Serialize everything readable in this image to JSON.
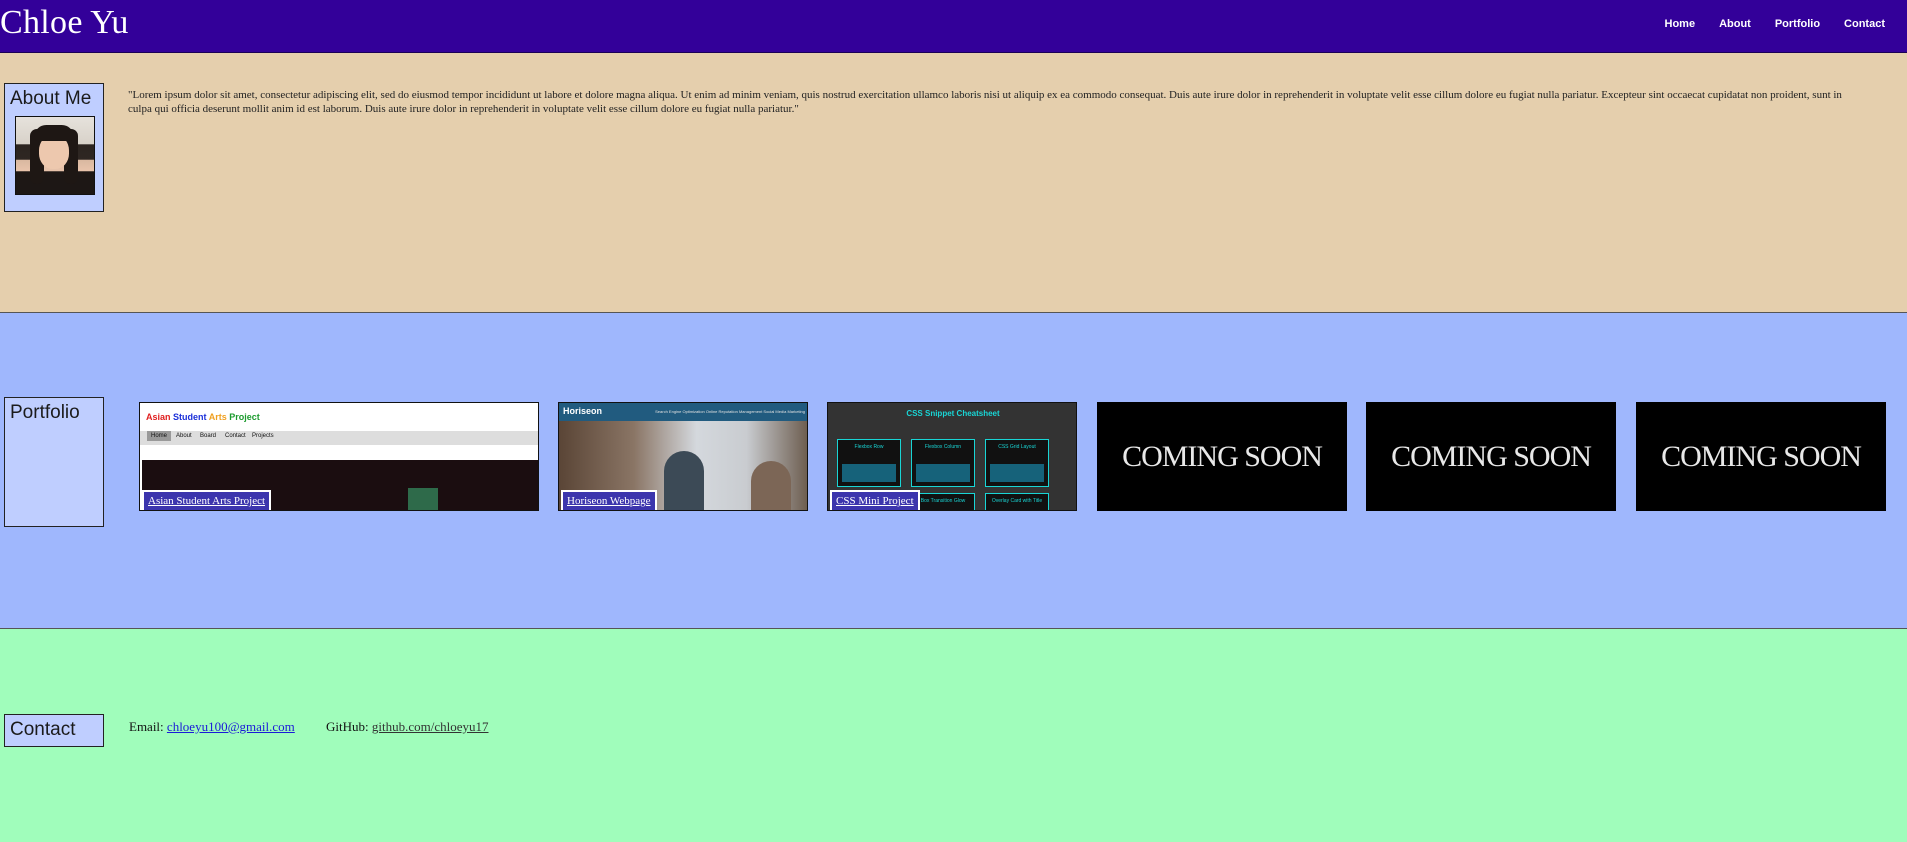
{
  "header": {
    "brand": "Chloe Yu",
    "nav": [
      "Home",
      "About",
      "Portfolio",
      "Contact"
    ]
  },
  "about": {
    "heading": "About Me",
    "avatar_icon": "profile-photo",
    "text": "\"Lorem ipsum dolor sit amet, consectetur adipiscing elit, sed do eiusmod tempor incididunt ut labore et dolore magna aliqua. Ut enim ad minim veniam, quis nostrud exercitation ullamco laboris nisi ut aliquip ex ea commodo consequat. Duis aute irure dolor in reprehenderit in voluptate velit esse cillum dolore eu fugiat nulla pariatur. Excepteur sint occaecat cupidatat non proident, sunt in culpa qui officia deserunt mollit anim id est laborum. Duis aute irure dolor in reprehenderit in voluptate velit esse cillum dolore eu fugiat nulla pariatur.\""
  },
  "portfolio": {
    "heading": "Portfolio",
    "projects": [
      {
        "caption": "Asian Student Arts Project",
        "preview_title": [
          "Asian",
          "Student",
          "Arts",
          "Project"
        ],
        "preview_nav": [
          "Home",
          "About",
          "Board",
          "Contact",
          "Projects"
        ]
      },
      {
        "caption": "Horiseon Webpage",
        "preview_title": "Horiseon",
        "preview_links": "Search Engine Optimization    Online Reputation Management    Social Media Marketing"
      },
      {
        "caption": "CSS Mini Project",
        "preview_title": "CSS Snippet Cheatsheet",
        "preview_cards": [
          "Flexbox Row",
          "Flexbox Column",
          "CSS Grid Layout",
          "Box Transition Glow",
          "Overlay Card with Title"
        ]
      }
    ],
    "coming_soon": [
      "COMING SOON",
      "COMING SOON",
      "COMING SOON"
    ]
  },
  "contact": {
    "heading": "Contact",
    "email_label": "Email:",
    "email": "chloeyu100@gmail.com",
    "github_label": "GitHub:",
    "github": "github.com/chloeyu17"
  },
  "colors": {
    "header": "#330099",
    "about_bg": "#e5cfad",
    "portfolio_bg": "#9fb7fd",
    "contact_bg": "#a0fdbb",
    "label_box": "#bfceff",
    "caption_bg": "#3c35ad"
  }
}
